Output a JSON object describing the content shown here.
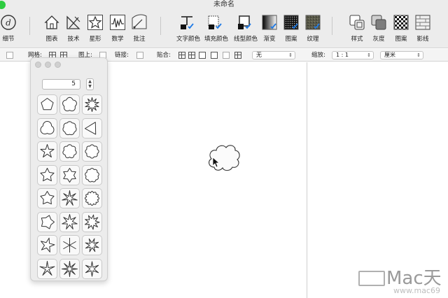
{
  "window": {
    "title": "未命名"
  },
  "toolbar": {
    "tools": [
      {
        "label": "细节",
        "icon": "detail-icon"
      },
      {
        "label": "图表",
        "icon": "house-chart-icon"
      },
      {
        "label": "技术",
        "icon": "technical-tools-icon"
      },
      {
        "label": "星形",
        "icon": "star-shape-icon"
      },
      {
        "label": "数学",
        "icon": "math-function-icon"
      },
      {
        "label": "批注",
        "icon": "annotation-gauge-icon"
      },
      {
        "label": "文字颜色",
        "icon": "text-color-icon"
      },
      {
        "label": "填充颜色",
        "icon": "fill-color-icon"
      },
      {
        "label": "线型颜色",
        "icon": "line-color-icon"
      },
      {
        "label": "渐变",
        "icon": "gradient-icon"
      },
      {
        "label": "图案",
        "icon": "pattern-icon"
      },
      {
        "label": "纹理",
        "icon": "texture-icon"
      },
      {
        "label": "样式",
        "icon": "style-icon"
      },
      {
        "label": "灰度",
        "icon": "grayscale-icon"
      },
      {
        "label": "图案",
        "icon": "checker-pattern-icon"
      },
      {
        "label": "影线",
        "icon": "hatch-icon"
      }
    ]
  },
  "options": {
    "grid_label": "网格:",
    "top_label": "图上:",
    "link_label": "链接:",
    "snap_label": "贴合:",
    "snap_value": "无",
    "zoom_label": "缩放:",
    "zoom_value": "1 : 1",
    "unit_value": "厘米"
  },
  "shape_panel": {
    "points_value": "5",
    "shapes": [
      "pentagon",
      "flower-5",
      "sun-burst",
      "trefoil-round",
      "heptagon-round",
      "triskelion",
      "pentagram",
      "flower-7",
      "cloud-8",
      "star-5-round",
      "star-6-soft",
      "gear-9",
      "star-5-fat",
      "star-7-thin",
      "sun-scallop",
      "pinwheel-5",
      "leaf-star",
      "swirl-fan",
      "propeller-5",
      "spoke-star",
      "spiral-shell",
      "thin-star-5",
      "asterisk-8",
      "asterisk-flower"
    ]
  },
  "canvas": {
    "selected_shape": "cloud"
  },
  "colors": {
    "chrome": "#ececec",
    "accent_check": "#1e7ae6",
    "traffic_green": "#2ecc40"
  },
  "watermark": {
    "brand": "Mac天",
    "url": "www.mac69"
  }
}
